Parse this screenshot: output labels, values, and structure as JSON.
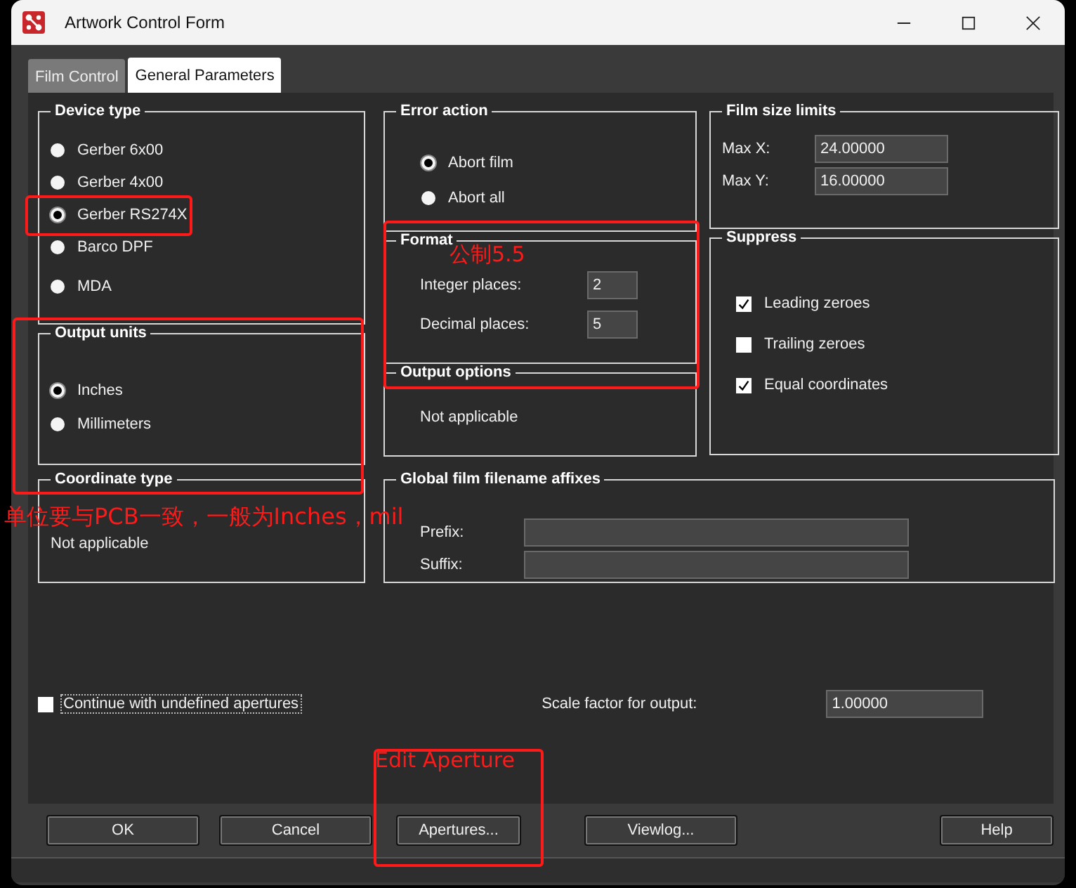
{
  "window": {
    "title": "Artwork Control Form"
  },
  "tabs": [
    {
      "label": "Film Control",
      "selected": false
    },
    {
      "label": "General Parameters",
      "selected": true
    }
  ],
  "device_type": {
    "title": "Device type",
    "options": [
      {
        "label": "Gerber 6x00",
        "selected": false
      },
      {
        "label": "Gerber 4x00",
        "selected": false
      },
      {
        "label": "Gerber RS274X",
        "selected": true
      },
      {
        "label": "Barco DPF",
        "selected": false
      },
      {
        "label": "MDA",
        "selected": false
      }
    ]
  },
  "output_units": {
    "title": "Output units",
    "options": [
      {
        "label": "Inches",
        "selected": true
      },
      {
        "label": "Millimeters",
        "selected": false
      }
    ]
  },
  "coordinate_type": {
    "title": "Coordinate type",
    "text": "Not applicable"
  },
  "error_action": {
    "title": "Error action",
    "options": [
      {
        "label": "Abort film",
        "selected": true
      },
      {
        "label": "Abort all",
        "selected": false
      }
    ]
  },
  "format": {
    "title": "Format",
    "fields": [
      {
        "label": "Integer places:",
        "value": "2"
      },
      {
        "label": "Decimal places:",
        "value": "5"
      }
    ]
  },
  "output_options": {
    "title": "Output options",
    "text": "Not applicable"
  },
  "film_size_limits": {
    "title": "Film size limits",
    "fields": [
      {
        "label": "Max X:",
        "value": "24.00000"
      },
      {
        "label": "Max Y:",
        "value": "16.00000"
      }
    ]
  },
  "suppress": {
    "title": "Suppress",
    "options": [
      {
        "label": "Leading zeroes",
        "checked": true
      },
      {
        "label": "Trailing zeroes",
        "checked": false
      },
      {
        "label": "Equal coordinates",
        "checked": true
      }
    ]
  },
  "filename_affixes": {
    "title": "Global film filename affixes",
    "fields": [
      {
        "label": "Prefix:"
      },
      {
        "label": "Suffix:"
      }
    ]
  },
  "continue_undefined": {
    "label": "Continue with undefined apertures",
    "checked": false
  },
  "scale_factor": {
    "label": "Scale factor for output:",
    "value": "1.00000"
  },
  "buttons": [
    "OK",
    "Cancel",
    "Apertures...",
    "Viewlog...",
    "Help"
  ],
  "annotations": [
    {
      "text": "公制5.5"
    },
    {
      "text": "单位要与PCB一致，一般为Inches，mil"
    },
    {
      "text": "Edit Aperture"
    }
  ]
}
